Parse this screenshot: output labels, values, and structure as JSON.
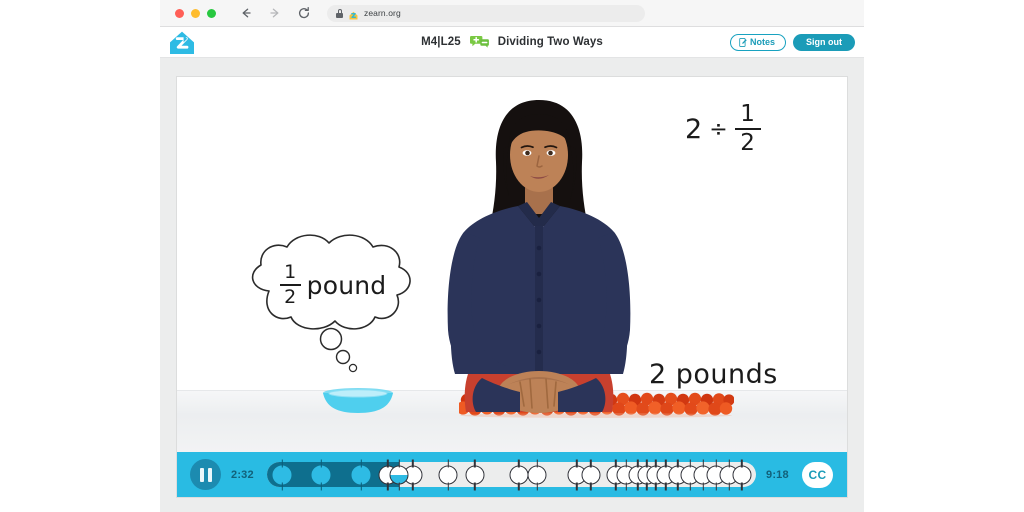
{
  "browser": {
    "window_controls": [
      "close",
      "minimize",
      "maximize"
    ],
    "back_icon": "back-arrow-icon",
    "forward_icon": "forward-arrow-icon",
    "reload_icon": "reload-icon",
    "lock_icon": "lock-icon",
    "favicon": "zearn-favicon",
    "url": "zearn.org"
  },
  "header": {
    "logo": "zearn-house-logo",
    "lesson_code": "M4|L25",
    "lesson_icon": "green-chat-bubbles-icon",
    "lesson_title": "Dividing Two Ways",
    "notes_label": "Notes",
    "notes_icon": "note-pencil-icon",
    "signout_label": "Sign out",
    "accent_color": "#1b9cb8"
  },
  "video": {
    "math_expression": {
      "whole": "2",
      "operator": "÷",
      "fraction_numerator": "1",
      "fraction_denominator": "2"
    },
    "thought_bubble": {
      "fraction_numerator": "1",
      "fraction_denominator": "2",
      "word": "pound"
    },
    "scene_label": "2 pounds",
    "bowl_color": "#5cd2ef",
    "tomato_color": "#e8441c",
    "shirt_color": "#2b3459",
    "belt_color": "#c8402e"
  },
  "player": {
    "play_pause_icon": "pause-icon",
    "state": "playing",
    "current_time": "2:32",
    "duration": "9:18",
    "progress_percent": 27,
    "cc_label": "CC",
    "bar_color": "#29bbe3",
    "fill_color": "#0e6f8e",
    "chapter_markers": [
      {
        "position": 4.2,
        "done": true
      },
      {
        "position": 15.0,
        "done": true
      },
      {
        "position": 26.0,
        "done": true
      },
      {
        "position": 33.4,
        "done": false
      },
      {
        "position": 40.3,
        "done": false
      },
      {
        "position": 50.0,
        "done": false
      },
      {
        "position": 57.4,
        "done": false
      },
      {
        "position": 69.5,
        "done": false
      },
      {
        "position": 74.6,
        "done": false
      },
      {
        "position": 85.5,
        "done": false
      },
      {
        "position": 89.4,
        "done": false
      },
      {
        "position": 96.3,
        "done": false
      },
      {
        "position": 99.2,
        "done": false
      },
      {
        "position": 102.4,
        "done": false
      },
      {
        "position": 104.9,
        "done": false
      },
      {
        "position": 107.3,
        "done": false
      },
      {
        "position": 110.1,
        "done": false
      },
      {
        "position": 113.4,
        "done": false
      },
      {
        "position": 116.9,
        "done": false
      },
      {
        "position": 120.4,
        "done": false
      },
      {
        "position": 124.0,
        "done": false
      },
      {
        "position": 127.6,
        "done": false
      },
      {
        "position": 131.1,
        "done": false
      }
    ]
  }
}
